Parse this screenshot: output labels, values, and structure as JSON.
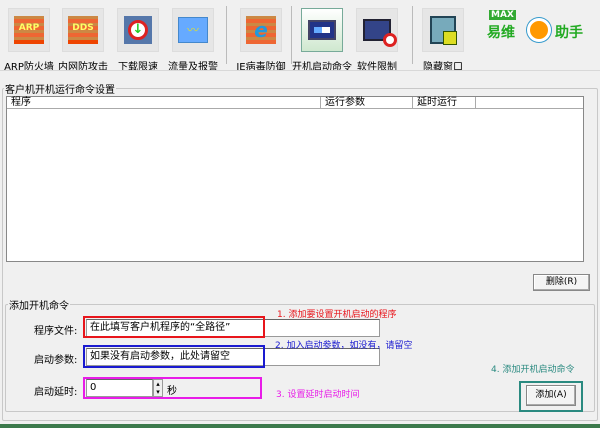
{
  "toolbar": [
    {
      "label": "ARP防火墙",
      "icon": "arp-firewall-icon",
      "badge": "ARP"
    },
    {
      "label": "内网防攻击",
      "icon": "intranet-defense-icon",
      "badge": "DDS"
    },
    {
      "label": "下载限速",
      "icon": "download-limit-icon"
    },
    {
      "label": "流量及报警",
      "icon": "traffic-alarm-icon"
    },
    {
      "label": "IE病毒防御",
      "icon": "ie-virus-defense-icon"
    },
    {
      "label": "开机启动命令",
      "icon": "startup-command-icon",
      "selected": true
    },
    {
      "label": "软件限制",
      "icon": "software-limit-icon"
    },
    {
      "label": "隐藏窗口",
      "icon": "hide-window-icon"
    }
  ],
  "logo": {
    "text_max": "MAX",
    "text_left": "易维",
    "text_right": "助手"
  },
  "list_group": {
    "title": "客户机开机运行命令设置",
    "columns": [
      "程序",
      "运行参数",
      "延时运行"
    ]
  },
  "delete_button": "删除(R)",
  "add_group": {
    "title": "添加开机命令",
    "program_label": "程序文件:",
    "program_value": "在此填写客户机程序的“全路径”",
    "params_label": "启动参数:",
    "params_value": "如果没有启动参数，此处请留空",
    "delay_label": "启动延时:",
    "delay_value": "0",
    "delay_unit": "秒",
    "add_button": "添加(A)"
  },
  "annotations": {
    "a1": "1. 添加要设置开机启动的程序",
    "a2": "2. 加入启动参数，如没有，请留空",
    "a3": "3. 设置延时启动时间",
    "a4": "4. 添加开机启动命令"
  },
  "colors": {
    "red": "#e8151b",
    "blue": "#1a1ad0",
    "magenta": "#e81ce8",
    "teal": "#2a8a80"
  }
}
